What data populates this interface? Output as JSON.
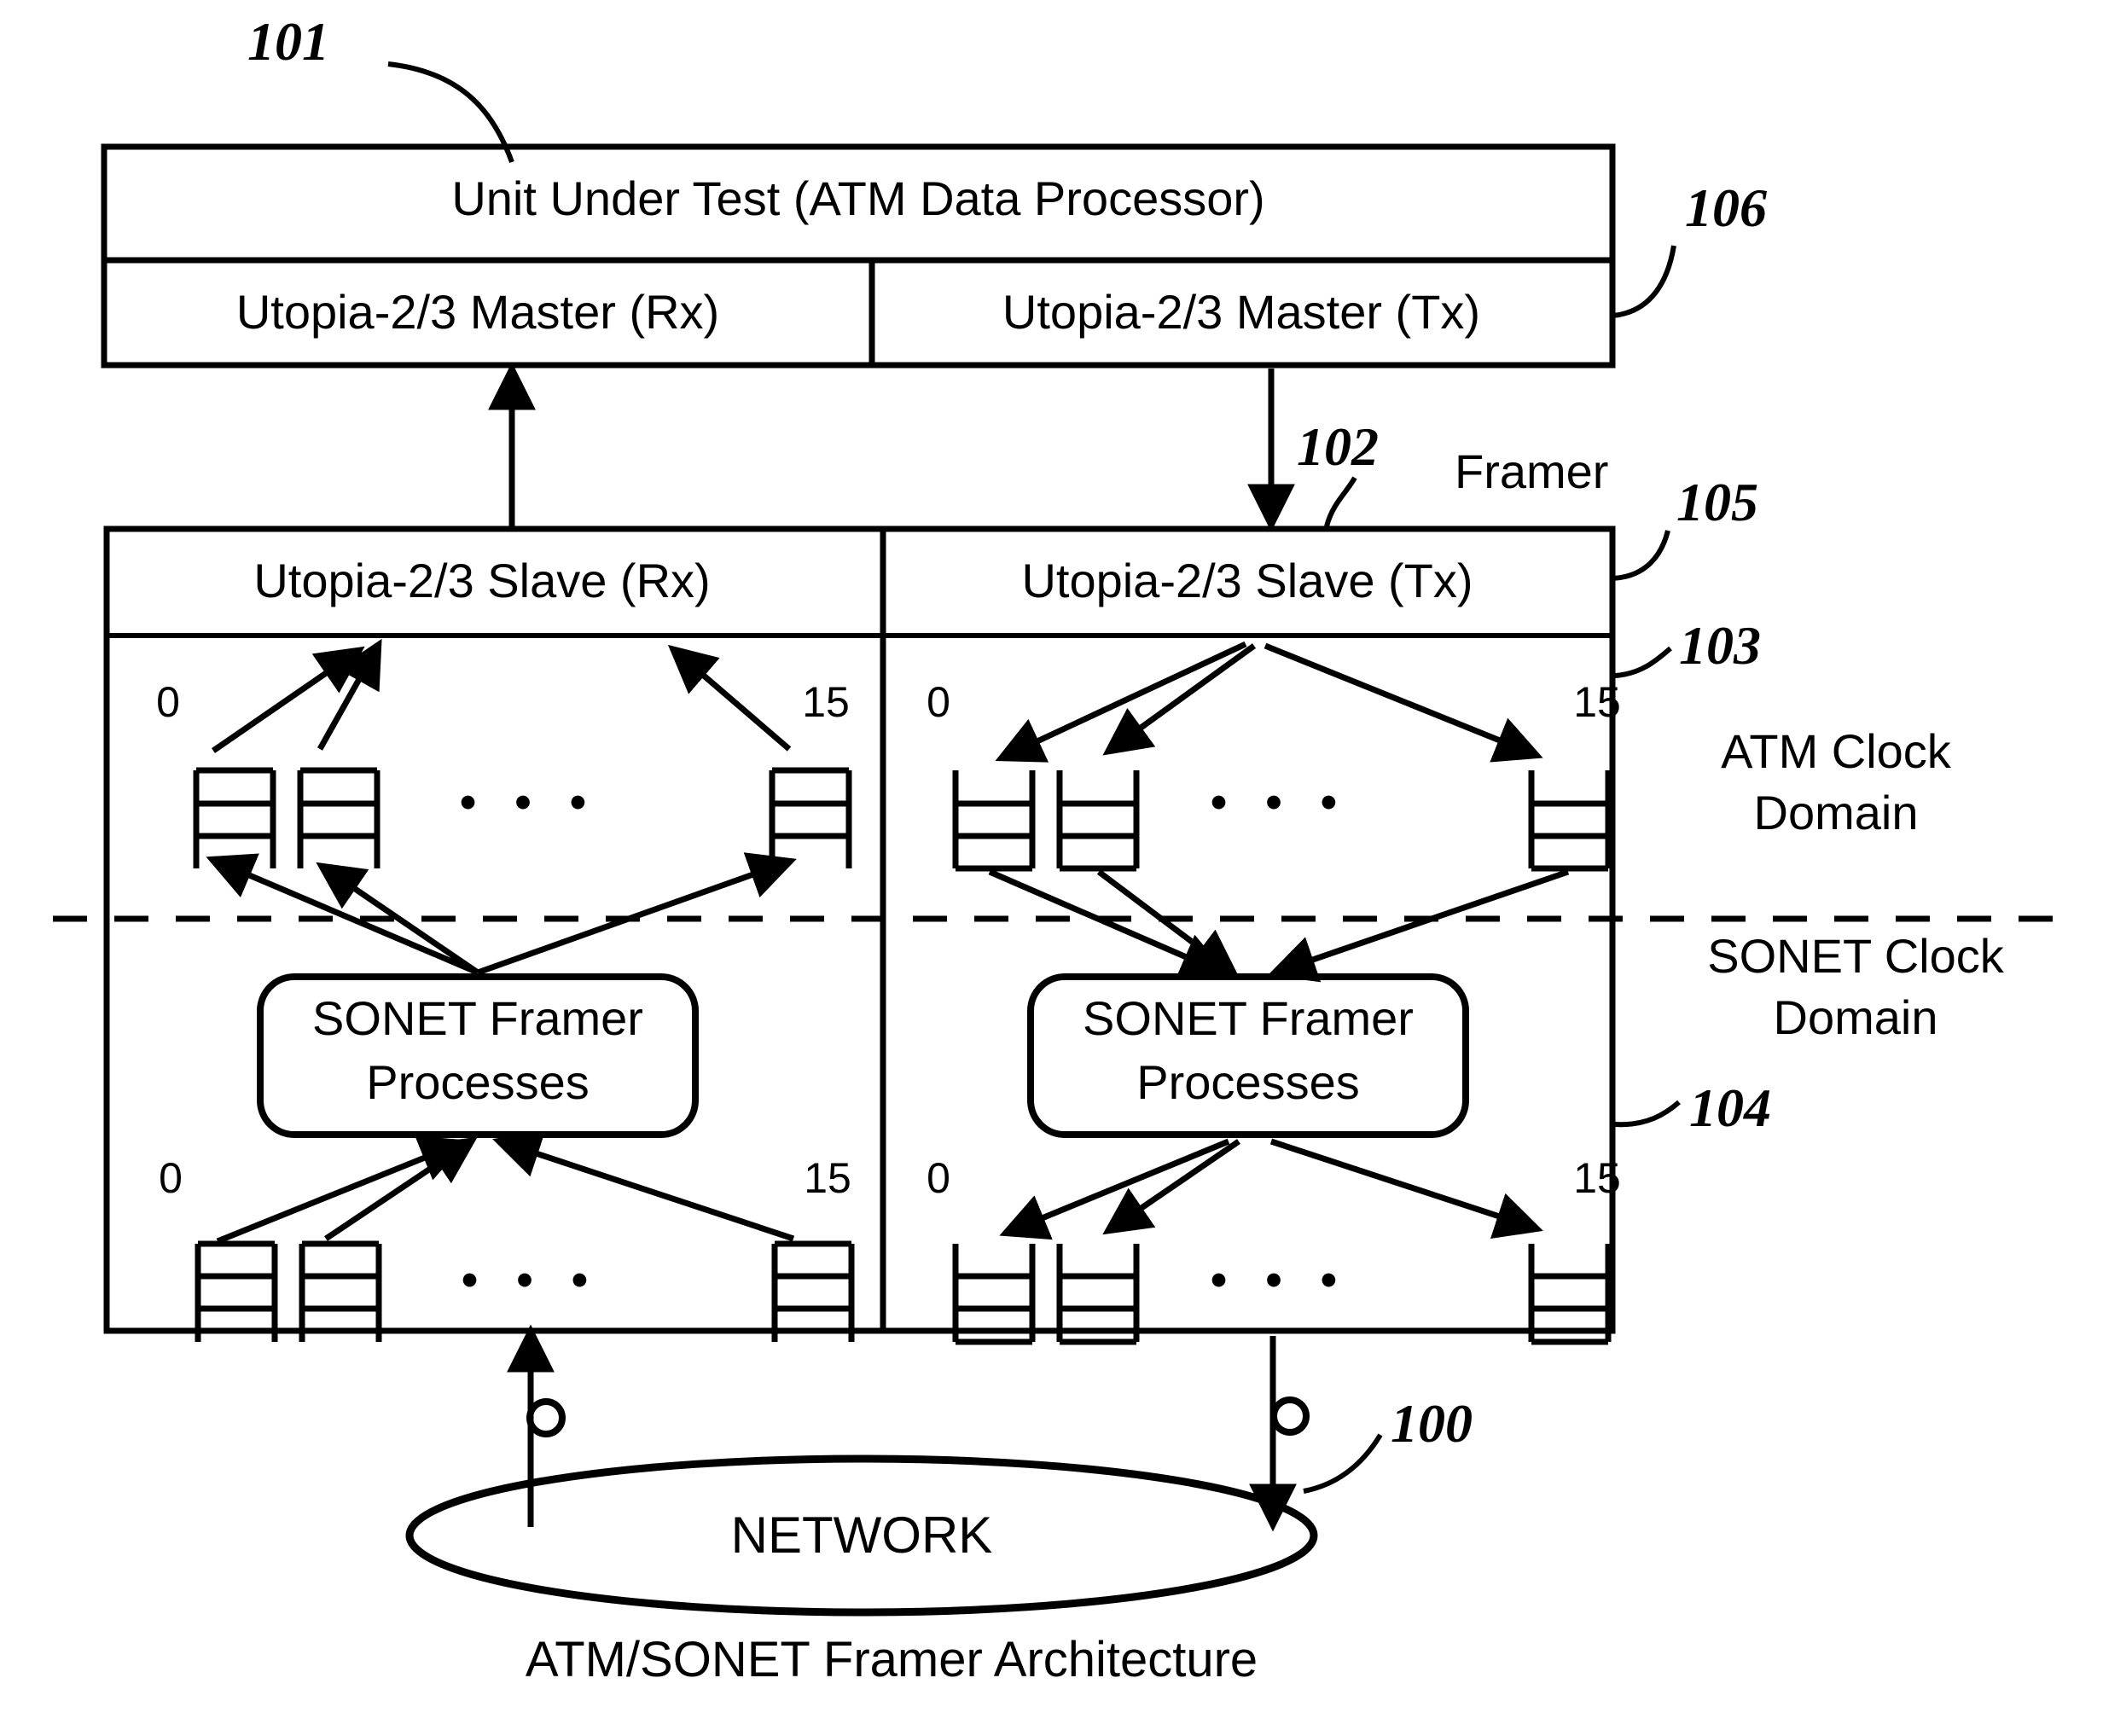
{
  "diagram": {
    "caption": "ATM/SONET Framer Architecture",
    "ink_color": "#000000",
    "background_color": "#ffffff",
    "uut": {
      "title": "Unit Under Test (ATM Data Processor)",
      "ref": "101",
      "interface_ref": "106",
      "ports": [
        {
          "label": "Utopia-2/3 Master (Rx)"
        },
        {
          "label": "Utopia-2/3 Master (Tx)"
        }
      ]
    },
    "framer": {
      "label": "Framer",
      "ref": "102",
      "interface_ref": "105",
      "ports": [
        {
          "label": "Utopia-2/3 Slave (Rx)"
        },
        {
          "label": "Utopia-2/3 Slave (Tx)"
        }
      ],
      "process_block_label_line1": "SONET Framer",
      "process_block_label_line2": "Processes",
      "fifo_index_first": "0",
      "fifo_index_last": "15",
      "ellipsis": "• • •"
    },
    "domains": [
      {
        "ref": "103",
        "line1": "ATM Clock",
        "line2": "Domain"
      },
      {
        "ref": "104",
        "line1": "SONET Clock",
        "line2": "Domain"
      }
    ],
    "network": {
      "label": "NETWORK",
      "ref": "100"
    }
  }
}
